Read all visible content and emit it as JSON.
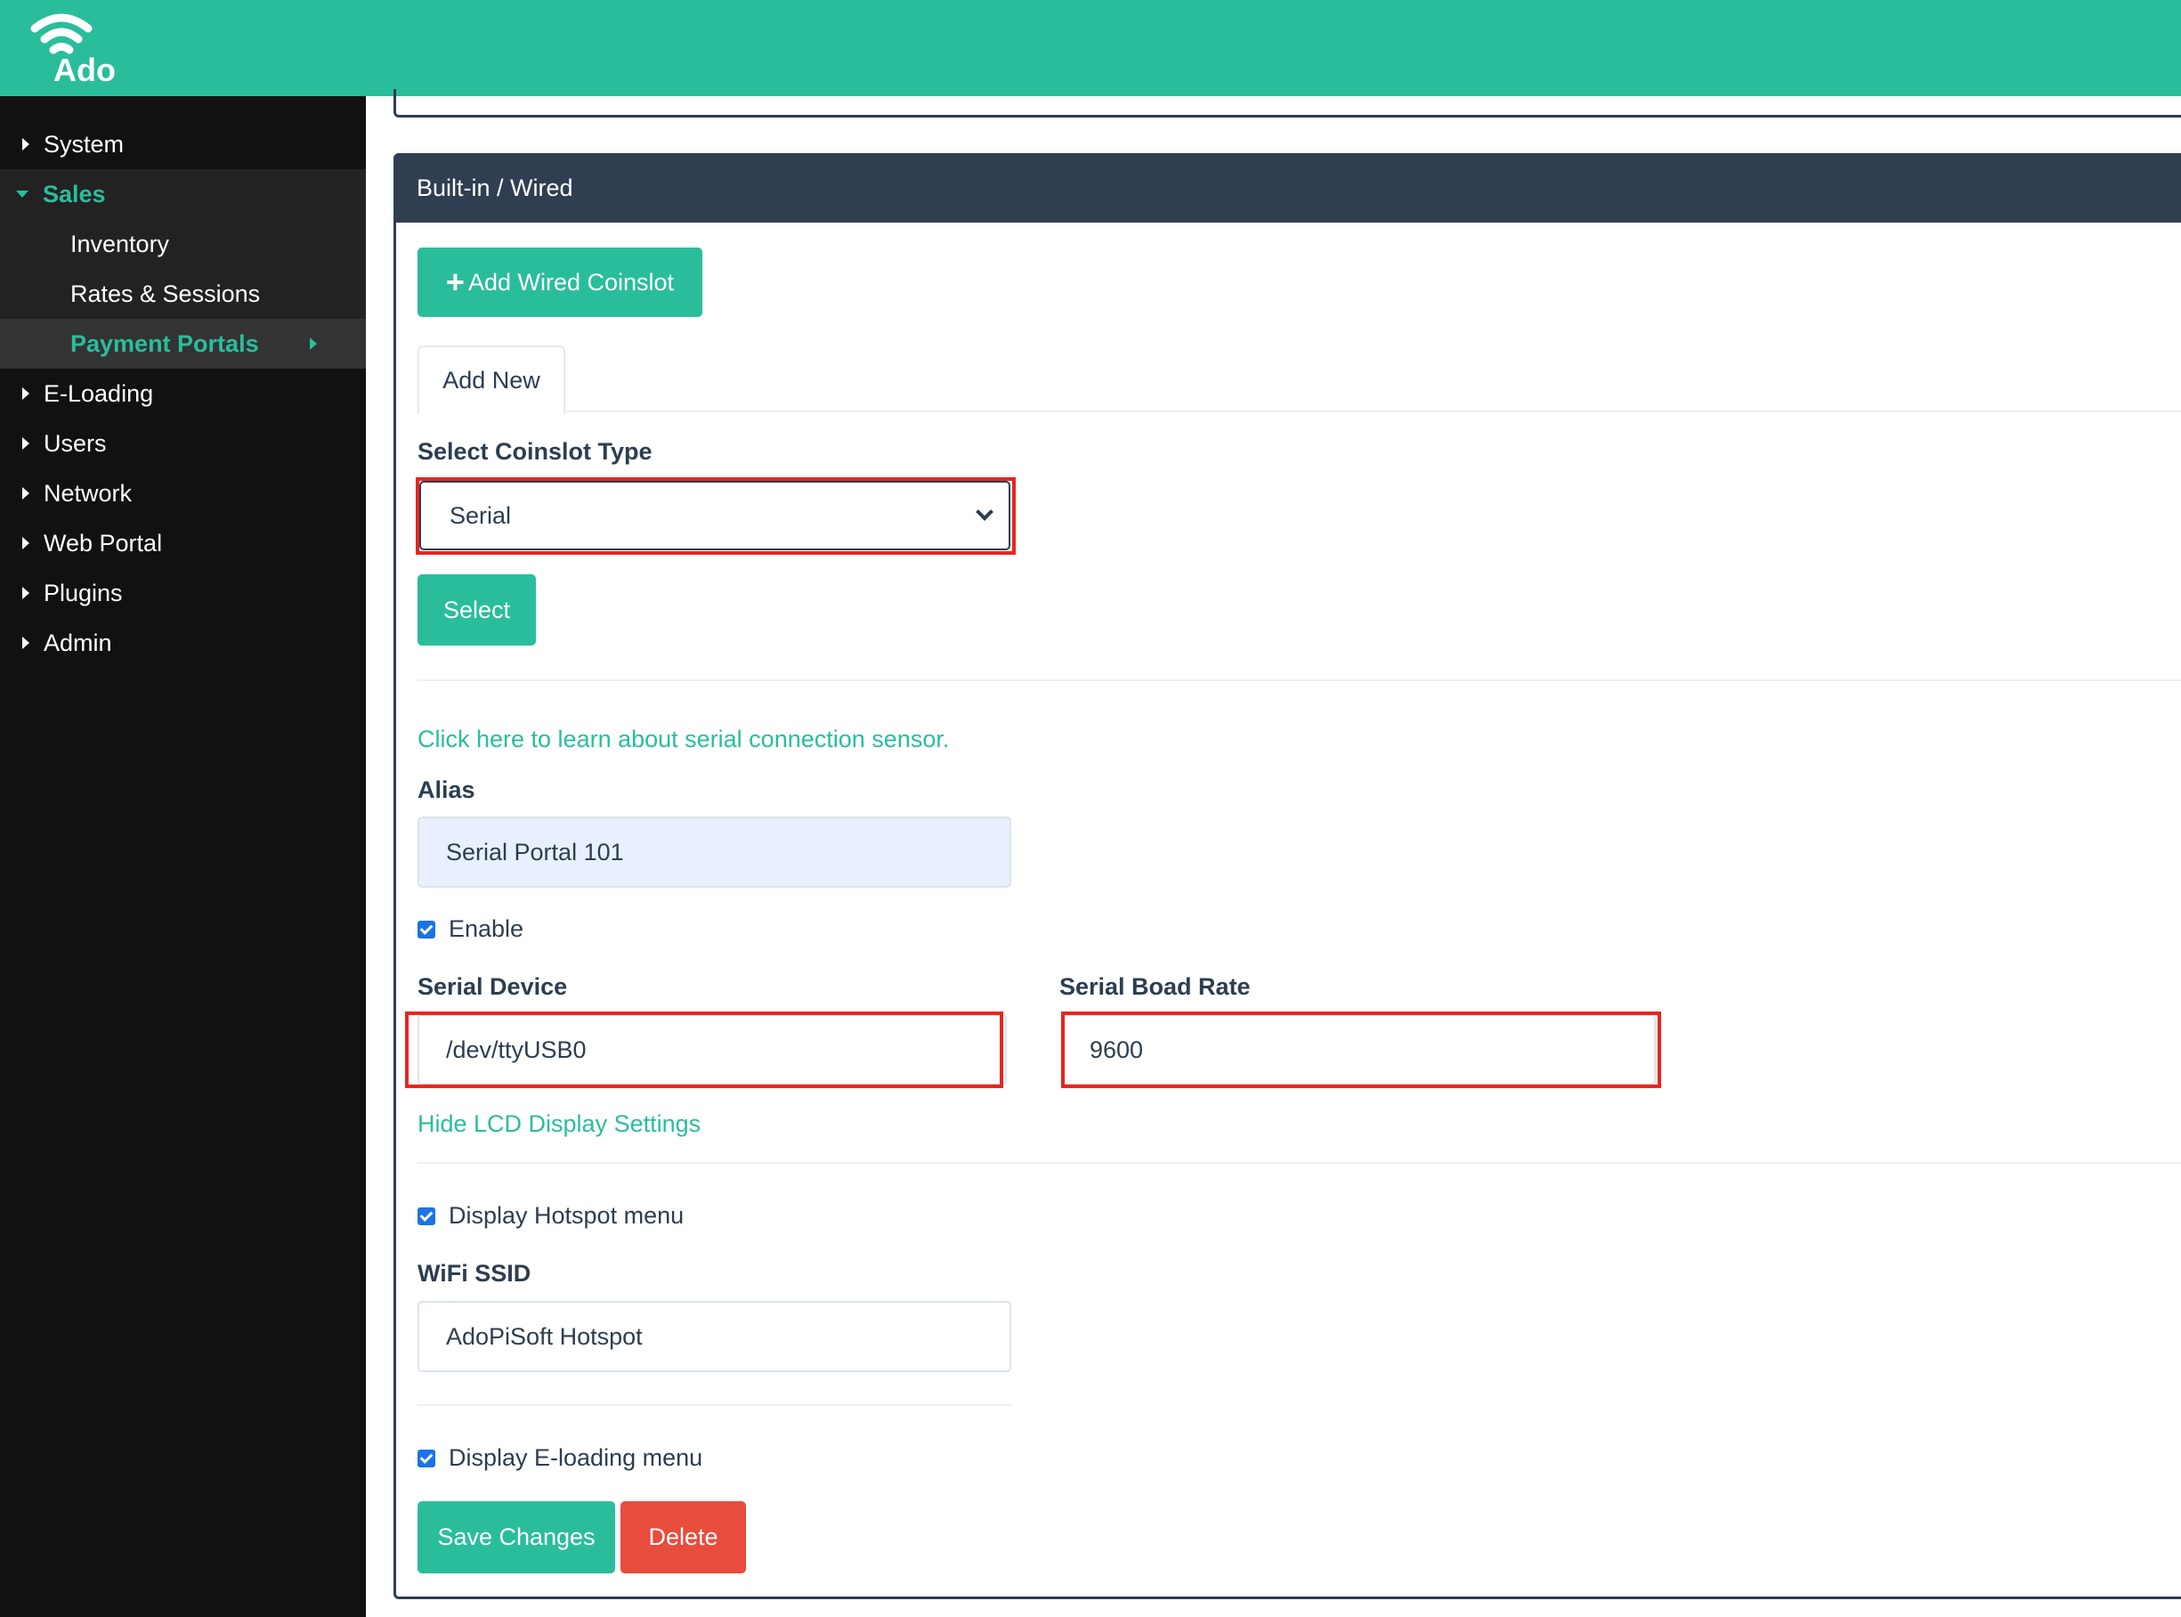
{
  "brand": {
    "name": "Ado",
    "color": "#2abd9c"
  },
  "sidebar": {
    "items": [
      {
        "label": "System"
      },
      {
        "label": "Sales",
        "expanded": true
      },
      {
        "label": "Inventory"
      },
      {
        "label": "Rates & Sessions"
      },
      {
        "label": "Payment Portals",
        "active": true
      },
      {
        "label": "E-Loading"
      },
      {
        "label": "Users"
      },
      {
        "label": "Network"
      },
      {
        "label": "Web Portal"
      },
      {
        "label": "Plugins"
      },
      {
        "label": "Admin"
      }
    ]
  },
  "card": {
    "title": "Built-in / Wired",
    "add_button": "Add Wired Coinslot",
    "tab": "Add New",
    "select_label": "Select Coinslot Type",
    "select_value": "Serial",
    "select_button": "Select",
    "learn_link": "Click here to learn about serial connection sensor.",
    "alias_label": "Alias",
    "alias_value": "Serial Portal 101",
    "enable_label": "Enable",
    "enable_checked": true,
    "serial_device_label": "Serial Device",
    "serial_device_value": "/dev/ttyUSB0",
    "baud_label": "Serial Boad Rate",
    "baud_value": "9600",
    "lcd_link": "Hide LCD Display Settings",
    "hotspot_label": "Display Hotspot menu",
    "hotspot_checked": true,
    "ssid_label": "WiFi SSID",
    "ssid_value": "AdoPiSoft Hotspot",
    "eloading_label": "Display E-loading menu",
    "eloading_checked": true,
    "save_button": "Save Changes",
    "delete_button": "Delete"
  },
  "colors": {
    "accent": "#2abd9c",
    "header": "#2f3e50",
    "danger": "#e74c3c",
    "highlight": "#e8261f"
  }
}
